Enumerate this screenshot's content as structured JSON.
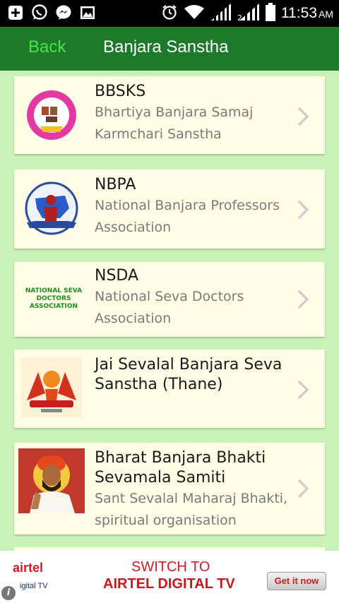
{
  "status_bar": {
    "time": "11:53",
    "ampm": "AM",
    "icons_left": [
      "plus-icon",
      "whatsapp-icon",
      "messenger-icon",
      "gallery-icon"
    ],
    "icons_right": [
      "alarm-icon",
      "wifi-icon",
      "signal-icon",
      "signal-2-icon",
      "battery-icon"
    ]
  },
  "toolbar": {
    "back_label": "Back",
    "title": "Banjara Sanstha"
  },
  "items": [
    {
      "abbr": "BBSKS",
      "full": "Bhartiya Banjara Samaj Karmchari Sanstha",
      "logo": "bbsks-logo"
    },
    {
      "abbr": "NBPA",
      "full": "National Banjara Professors Association",
      "logo": "nbpa-logo"
    },
    {
      "abbr": "NSDA",
      "full": "National Seva Doctors Association",
      "logo": "nsda-logo",
      "logo_text": "NATIONAL SEVA DOCTORS ASSOCIATION"
    },
    {
      "abbr": "Jai Sevalal Banjara Seva Sanstha (Thane)",
      "full": "",
      "logo": "jai-sevalal-logo"
    },
    {
      "abbr": "Bharat Banjara Bhakti Sevamala Samiti",
      "full": "Sant Sevalal Maharaj Bhakti, spiritual organisation",
      "logo": "sevalal-maharaj-photo"
    }
  ],
  "ad": {
    "brand": "airtel",
    "brand_sub": "igital TV",
    "line1": "SWITCH TO",
    "line2": "AIRTEL DIGITAL TV",
    "cta": "Get it now",
    "info": "i"
  },
  "colors": {
    "toolbar": "#1d7a2b",
    "back": "#4ee24a",
    "background": "#c9f2b6",
    "card": "#fefee6",
    "ad_red": "#d51b22"
  }
}
